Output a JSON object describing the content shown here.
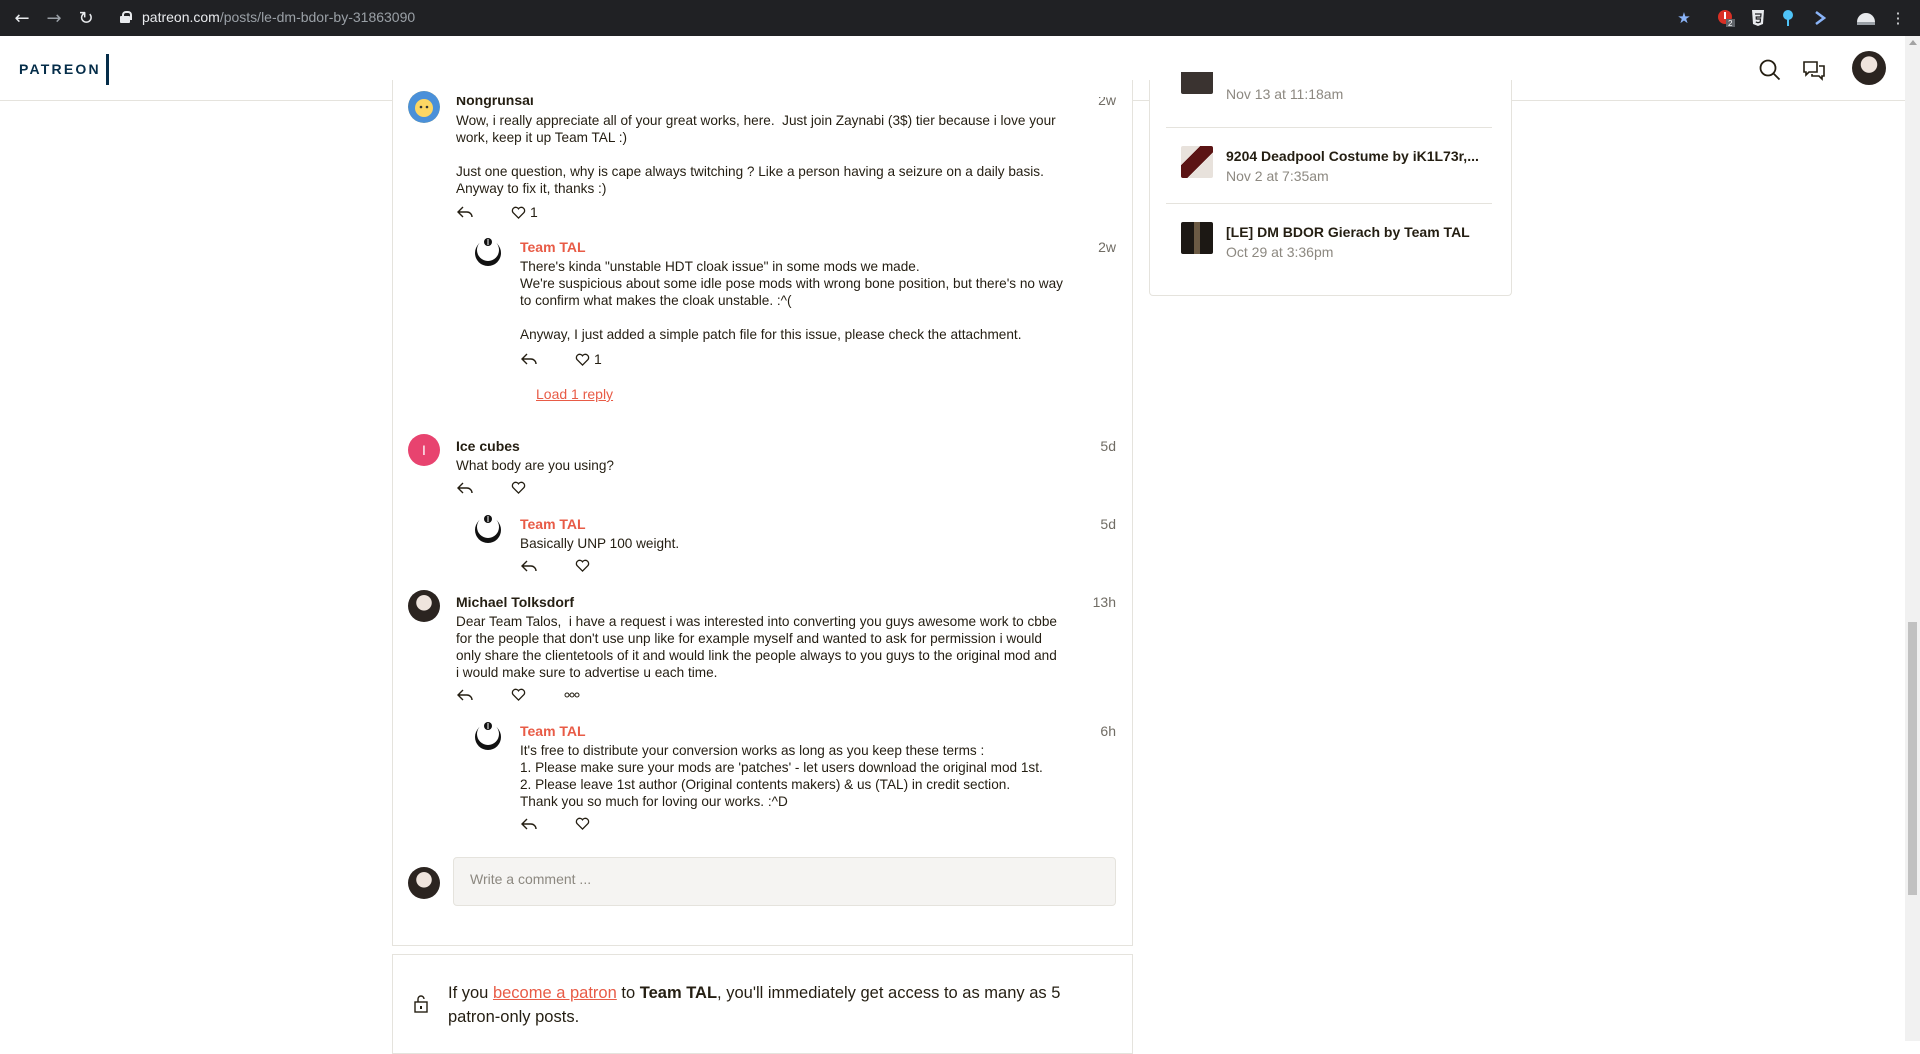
{
  "browser": {
    "url_domain": "patreon.com",
    "url_path": "/posts/le-dm-bdor-by-31863090",
    "extension_badge": "2"
  },
  "header": {
    "logo": "PATREON"
  },
  "comments": [
    {
      "name": "Nongrunsai",
      "time": "2w",
      "text": "Wow, i really appreciate all of your great works, here.  Just join Zaynabi (3$) tier because i love your\nwork, keep it up Team TAL :)\n\nJust one question, why is cape always twitching ? Like a person having a seizure on a daily basis.\nAnyway to fix it, thanks :)",
      "likes": "1",
      "reply": {
        "name": "Team TAL",
        "time": "2w",
        "text": "There's kinda \"unstable HDT cloak issue\" in some mods we made.\nWe're suspicious about some idle pose mods with wrong bone position, but there's no way\nto confirm what makes the cloak unstable. :^(\n\nAnyway, I just added a simple patch file for this issue, please check the attachment.",
        "likes": "1"
      },
      "load_reply": "Load 1 reply"
    },
    {
      "name": "Ice cubes",
      "initial": "I",
      "time": "5d",
      "text": "What body are you using?",
      "likes": "",
      "reply": {
        "name": "Team TAL",
        "time": "5d",
        "text": "Basically UNP 100 weight.",
        "likes": ""
      }
    },
    {
      "name": "Michael Tolksdorf",
      "time": "13h",
      "text": "Dear Team Talos,  i have a request i was interested into converting you guys awesome work to cbbe\nfor the people that don't use unp like for example myself and wanted to ask for permission i would\nonly share the clientetools of it and would link the people always to you guys to the original mod and\ni would make sure to advertise u each time.",
      "likes": "",
      "reply": {
        "name": "Team TAL",
        "time": "6h",
        "text": "It's free to distribute your conversion works as long as you keep these terms :\n1. Please make sure your mods are 'patches' - let users download the original mod 1st.\n2. Please leave 1st author (Original contents makers) & us (TAL) in credit section.\nThank you so much for loving our works. :^D",
        "likes": ""
      }
    }
  ],
  "comment_input": {
    "placeholder": "Write a comment ..."
  },
  "patron_notice": {
    "prefix": "If you ",
    "link": "become a patron",
    "middle": " to ",
    "creator": "Team TAL",
    "suffix": ", you'll immediately get access to as many as 5 patron-only posts."
  },
  "sidebar": {
    "items": [
      {
        "title": "",
        "date": "Nov 13 at 11:18am"
      },
      {
        "title": "9204 Deadpool Costume by iK1L73r,...",
        "date": "Nov 2 at 7:35am"
      },
      {
        "title": "[LE] DM BDOR Gierach by Team TAL",
        "date": "Oct 29 at 3:36pm"
      }
    ]
  },
  "colors": {
    "accent": "#e85b46",
    "brand_navy": "#052d49",
    "chrome": "#202124",
    "ice_avatar": "#e8436f"
  }
}
